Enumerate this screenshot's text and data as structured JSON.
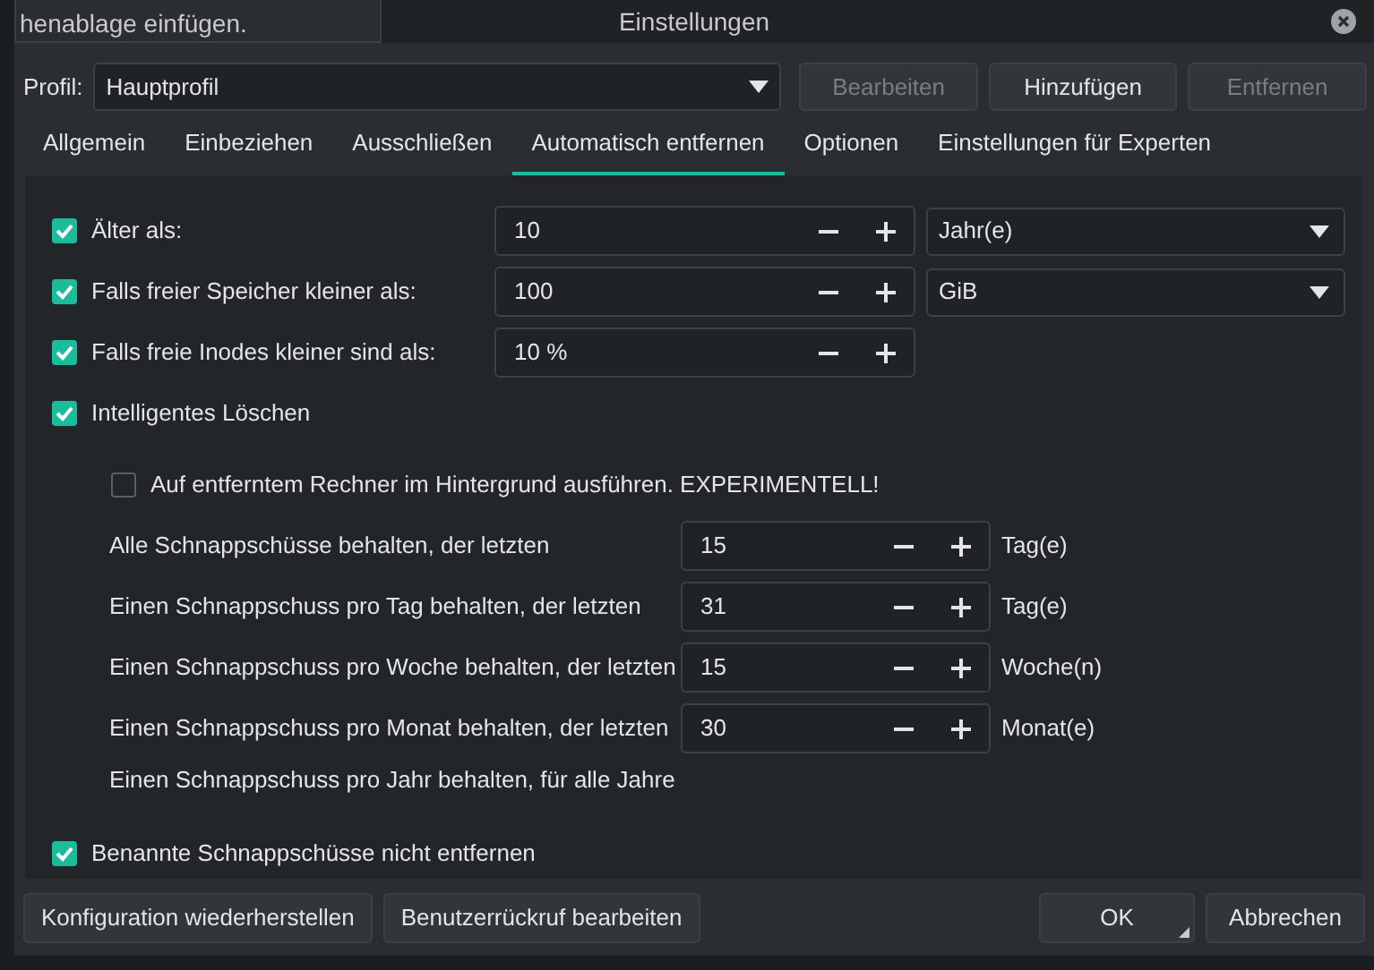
{
  "tooltip": "henablage einfügen.",
  "window": {
    "title": "Einstellungen"
  },
  "profile": {
    "label": "Profil:",
    "value": "Hauptprofil"
  },
  "profile_buttons": [
    {
      "label": "Bearbeiten",
      "disabled": true
    },
    {
      "label": "Hinzufügen",
      "disabled": false
    },
    {
      "label": "Entfernen",
      "disabled": true
    }
  ],
  "tabs": [
    {
      "label": "Allgemein",
      "selected": false
    },
    {
      "label": "Einbeziehen",
      "selected": false
    },
    {
      "label": "Ausschließen",
      "selected": false
    },
    {
      "label": "Automatisch entfernen",
      "selected": true
    },
    {
      "label": "Optionen",
      "selected": false
    },
    {
      "label": "Einstellungen für Experten",
      "selected": false
    }
  ],
  "rules": [
    {
      "kind": "spin-dropdown",
      "checked": true,
      "label": "Älter als:",
      "value": "10",
      "unit": "Jahr(e)"
    },
    {
      "kind": "spin-dropdown",
      "checked": true,
      "label": "Falls freier Speicher kleiner als:",
      "value": "100",
      "unit": "GiB"
    },
    {
      "kind": "spin",
      "checked": true,
      "label": "Falls freie Inodes kleiner sind als:",
      "value": "10 %"
    }
  ],
  "smart_delete": {
    "checked": true,
    "label": "Intelligentes Löschen",
    "remote": {
      "checked": false,
      "label": "Auf entferntem Rechner im Hintergrund ausführen. EXPERIMENTELL!"
    },
    "keep": [
      {
        "label": "Alle Schnappschüsse behalten, der letzten",
        "value": "15",
        "unit": "Tag(e)"
      },
      {
        "label": "Einen Schnappschuss pro Tag behalten, der letzten",
        "value": "31",
        "unit": "Tag(e)"
      },
      {
        "label": "Einen Schnappschuss pro Woche behalten, der letzten",
        "value": "15",
        "unit": "Woche(n)"
      },
      {
        "label": "Einen Schnappschuss pro Monat behalten, der letzten",
        "value": "30",
        "unit": "Monat(e)"
      }
    ],
    "yearly": "Einen Schnappschuss pro Jahr behalten, für alle Jahre"
  },
  "named": {
    "checked": true,
    "label": "Benannte Schnappschüsse nicht entfernen"
  },
  "footer_left": [
    "Konfiguration wiederherstellen",
    "Benutzerrückruf bearbeiten"
  ],
  "footer_right": [
    {
      "label": "OK",
      "default": true
    },
    {
      "label": "Abbrechen",
      "default": false
    }
  ]
}
